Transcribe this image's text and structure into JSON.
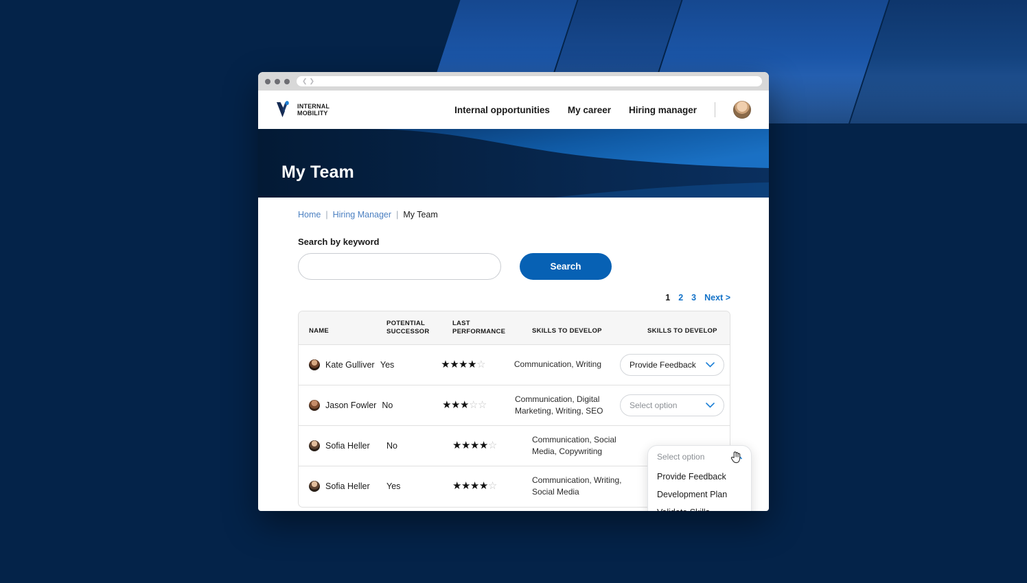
{
  "browser": {
    "url_value": "",
    "back_icon": "chevron-left-icon",
    "forward_icon": "chevron-right-icon"
  },
  "header": {
    "logo_line1": "INTERNAL",
    "logo_line2": "MOBILITY",
    "nav": [
      {
        "label": "Internal opportunities"
      },
      {
        "label": "My career"
      },
      {
        "label": "Hiring manager"
      }
    ]
  },
  "hero": {
    "title": "My Team"
  },
  "breadcrumb": {
    "items": [
      {
        "label": "Home",
        "link": true
      },
      {
        "label": "Hiring Manager",
        "link": true
      },
      {
        "label": "My Team",
        "link": false
      }
    ],
    "separator": "|"
  },
  "search": {
    "label": "Search by keyword",
    "value": "",
    "placeholder": "",
    "button_label": "Search"
  },
  "pagination": {
    "pages": [
      {
        "label": "1",
        "current": true
      },
      {
        "label": "2",
        "current": false
      },
      {
        "label": "3",
        "current": false
      }
    ],
    "next_label": "Next >"
  },
  "table": {
    "columns": [
      {
        "label": "NAME"
      },
      {
        "label": "POTENTIAL\nSUCCESSOR",
        "line1": "POTENTIAL",
        "line2": "SUCCESSOR"
      },
      {
        "label": "LAST\nPERFORMANCE",
        "line1": "LAST",
        "line2": "PERFORMANCE"
      },
      {
        "label": "SKILLS TO DEVELOP"
      },
      {
        "label": "SKILLS TO DEVELOP"
      }
    ],
    "rows": [
      {
        "name": "Kate Gulliver",
        "potential_successor": "Yes",
        "rating": 4,
        "rating_max": 5,
        "skills": "Communication, Writing",
        "action_value": "Provide Feedback",
        "action_is_placeholder": false,
        "action_open": false
      },
      {
        "name": "Jason Fowler",
        "potential_successor": "No",
        "rating": 3,
        "rating_max": 5,
        "skills": "Communication, Digital Marketing, Writing, SEO",
        "action_value": "Select option",
        "action_is_placeholder": true,
        "action_open": false
      },
      {
        "name": "Sofia Heller",
        "potential_successor": "No",
        "rating": 4,
        "rating_max": 5,
        "skills": "Communication, Social Media, Copywriting",
        "action_value": "Select option",
        "action_is_placeholder": true,
        "action_open": true
      },
      {
        "name": "Sofia Heller",
        "potential_successor": "Yes",
        "rating": 4,
        "rating_max": 5,
        "skills": "Communication, Writing, Social Media",
        "action_value": "",
        "action_is_placeholder": true,
        "action_open": false
      }
    ],
    "dropdown_options": [
      {
        "label": "Provide Feedback"
      },
      {
        "label": "Development Plan"
      },
      {
        "label": "Validate Skills"
      }
    ]
  },
  "colors": {
    "page_background": "#042349",
    "hero_dark": "#06203f",
    "hero_light": "#0f5ba8",
    "primary_button": "#0761b4",
    "link_blue": "#1372c8",
    "breadcrumb_link": "#4a7fc1",
    "chevron_blue": "#1b7fd6",
    "table_header_bg": "#f6f6f6",
    "border": "#e0e0e0",
    "star_filled": "#111111",
    "star_empty": "#c4c4c4"
  }
}
